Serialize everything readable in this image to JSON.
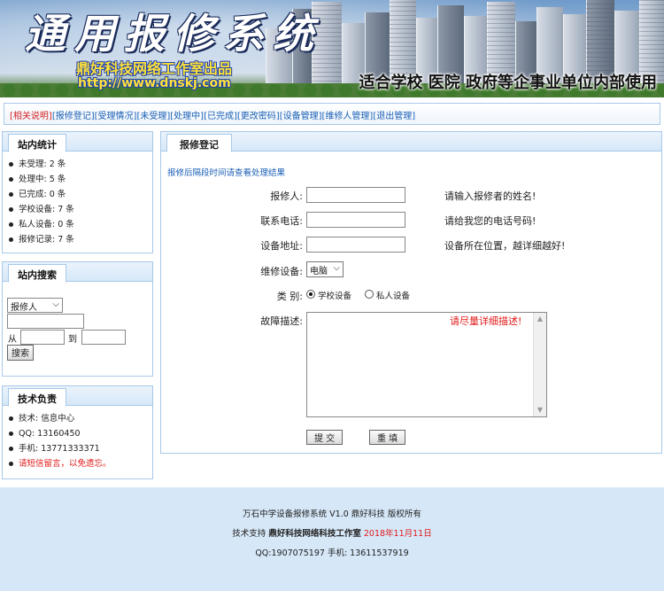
{
  "banner": {
    "title": "通用报修系统",
    "studio": "鼎好科技网络工作室出品",
    "url": "http://www.dnskj.com",
    "slogan": "适合学校 医院 政府等企事业单位内部使用"
  },
  "nav": {
    "items": [
      "[相关说明]",
      "[报修登记]",
      "[受理情况]",
      "[未受理]",
      "[处理中]",
      "[已完成]",
      "[更改密码]",
      "[设备管理]",
      "[维修人管理]",
      "[退出管理]"
    ]
  },
  "stats": {
    "title": "站内统计",
    "items": [
      "未受理: 2 条",
      "处理中: 5 条",
      "已完成: 0 条",
      "学校设备: 7 条",
      "私人设备: 0 条",
      "报修记录: 7 条"
    ]
  },
  "search": {
    "title": "站内搜索",
    "field_select": "报修人",
    "from_label": "从",
    "to_label": "到",
    "button": "搜索"
  },
  "tech": {
    "title": "技术负责",
    "items": [
      "技术: 信息中心",
      "QQ: 13160450",
      "手机: 13771333371"
    ],
    "warning": "请短信留言，以免遗忘。"
  },
  "main": {
    "tab": "报修登记",
    "note": "报修后隔段时间请查看处理结果",
    "fields": {
      "reporter_label": "报修人:",
      "reporter_hint": "请输入报修者的姓名!",
      "phone_label": "联系电话:",
      "phone_hint": "请给我您的电话号码!",
      "address_label": "设备地址:",
      "address_hint": "设备所在位置，越详细越好!",
      "device_label": "维修设备:",
      "device_value": "电脑",
      "type_label": "类  别:",
      "type_option1": "学校设备",
      "type_option2": "私人设备",
      "fault_label": "故障描述:",
      "fault_hint": "请尽量详细描述!"
    },
    "submit": "提 交",
    "reset": "重 填"
  },
  "footer": {
    "line1": "万石中学设备报修系统 V1.0 鼎好科技 版权所有",
    "support_label": "技术支持",
    "support_name": "鼎好科技网络科技工作室",
    "date": "2018年11月11日",
    "line3": "QQ:1907075197 手机: 13611537919"
  },
  "colors": {
    "link_blue": "#1a5fb4",
    "accent_red": "#e01a1a",
    "border_blue": "#a8c8e8",
    "footer_bg": "#d6e7f7"
  }
}
